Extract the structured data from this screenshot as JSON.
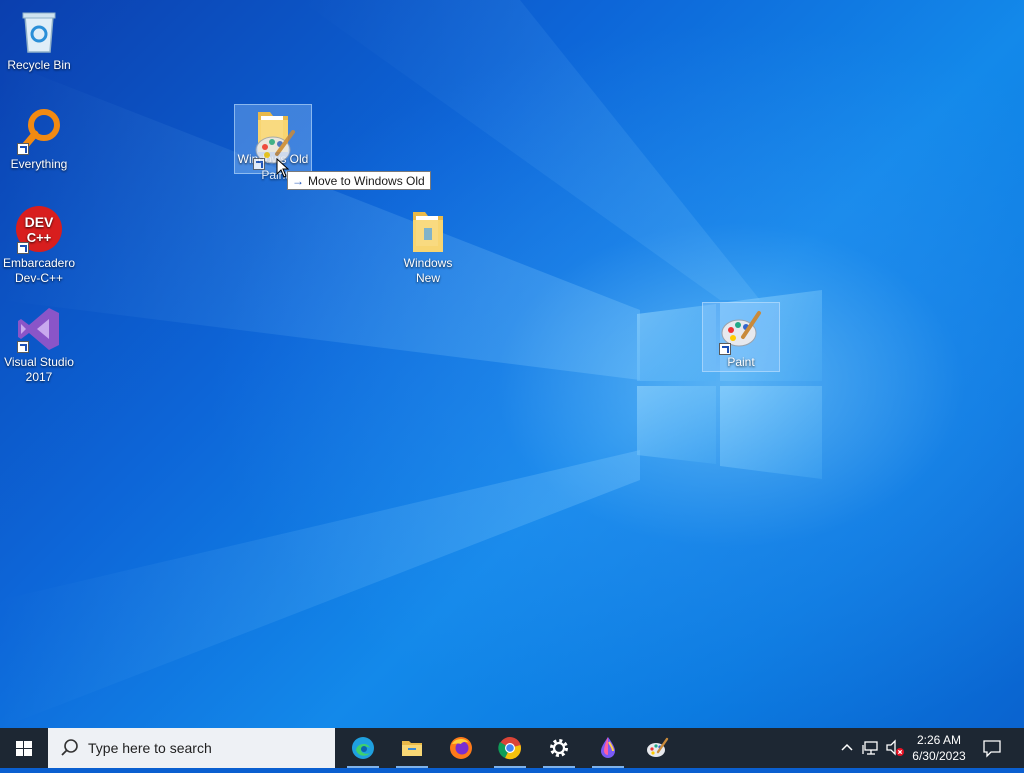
{
  "desktop": {
    "icons": [
      {
        "label": "Recycle Bin"
      },
      {
        "label": "Everything"
      },
      {
        "label": "Embarcadero Dev-C++"
      },
      {
        "label": "Visual Studio 2017"
      },
      {
        "label": "Windows New"
      },
      {
        "label": "Windows Old"
      },
      {
        "label": "Paint"
      }
    ],
    "drag_ghost_label": "Paint",
    "devcpp_logo_text": [
      "DEV",
      "C++"
    ]
  },
  "tooltip": {
    "arrow": "→",
    "text": "Move to Windows Old"
  },
  "taskbar": {
    "search_placeholder": "Type here to search",
    "apps": [
      "edge-icon",
      "file-explorer-icon",
      "firefox-icon",
      "chrome-icon",
      "settings-icon",
      "drop-icon",
      "paint-icon"
    ],
    "clock": {
      "time": "2:26 AM",
      "date": "6/30/2023"
    }
  },
  "colors": {
    "taskbar": "#1d2733",
    "desktop_accent": "#0d66d8",
    "search_bg": "#eef1f5"
  }
}
